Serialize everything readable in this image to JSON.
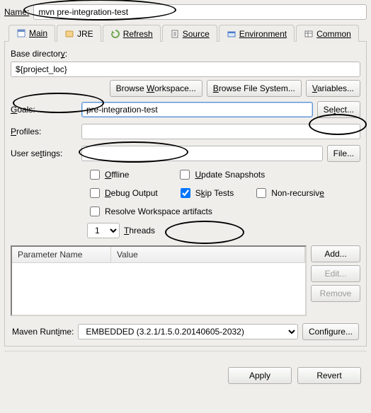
{
  "name_label": "Name:",
  "name_value": "mvn pre-integration-test",
  "tabs": {
    "main": "Main",
    "jre": "JRE",
    "refresh": "Refresh",
    "source": "Source",
    "environment": "Environment",
    "common": "Common"
  },
  "base_dir": {
    "label": "Base directory:",
    "value": "${project_loc}",
    "browse_ws": "Browse Workspace...",
    "browse_fs": "Browse File System...",
    "variables": "Variables..."
  },
  "goals": {
    "label": "Goals:",
    "value": "pre-integration-test",
    "select": "Select..."
  },
  "profiles": {
    "label": "Profiles:",
    "value": ""
  },
  "user_settings": {
    "label": "User settings:",
    "value": "",
    "file": "File..."
  },
  "checks": {
    "offline": "Offline",
    "update_snapshots": "Update Snapshots",
    "debug_output": "Debug Output",
    "skip_tests": "Skip Tests",
    "non_recursive": "Non-recursive",
    "resolve_ws": "Resolve Workspace artifacts",
    "skip_tests_checked": true
  },
  "threads": {
    "value": "1",
    "label": "Threads"
  },
  "params": {
    "col_name": "Parameter Name",
    "col_value": "Value",
    "add": "Add...",
    "edit": "Edit...",
    "remove": "Remove"
  },
  "runtime": {
    "label": "Maven Runtime:",
    "value": "EMBEDDED (3.2.1/1.5.0.20140605-2032)",
    "configure": "Configure..."
  },
  "footer": {
    "apply": "Apply",
    "revert": "Revert"
  }
}
